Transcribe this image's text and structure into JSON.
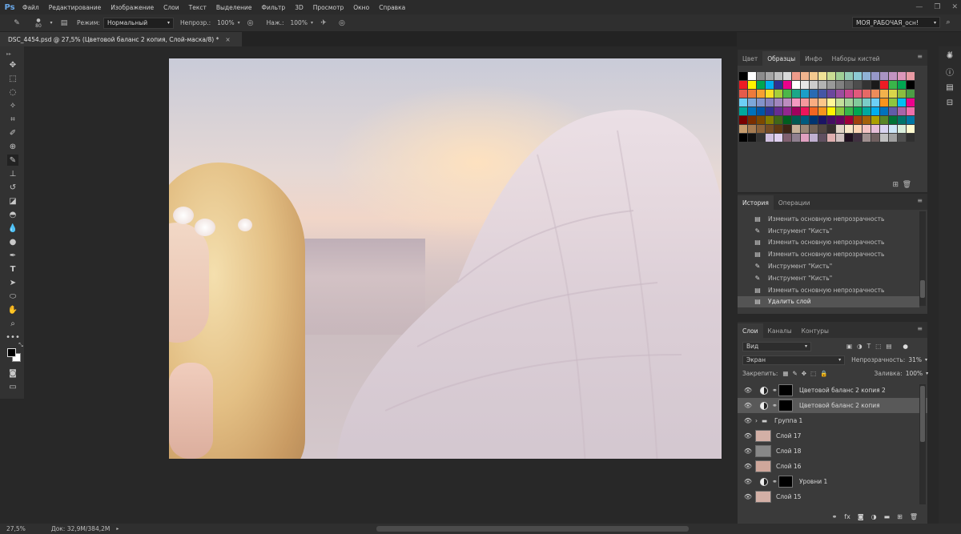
{
  "app": {
    "logo": "Ps"
  },
  "menu": [
    "Файл",
    "Редактирование",
    "Изображение",
    "Слои",
    "Текст",
    "Выделение",
    "Фильтр",
    "3D",
    "Просмотр",
    "Окно",
    "Справка"
  ],
  "options": {
    "brush_size": "80",
    "mode_label": "Режим:",
    "mode_value": "Нормальный",
    "opacity_label": "Непрозр.:",
    "opacity_value": "100%",
    "flow_label": "Наж.:",
    "flow_value": "100%",
    "workspace": "МОЯ_РАБОЧАЯ_осн!"
  },
  "document_tab": {
    "title": "DSC_4454.psd @ 27,5% (Цветовой баланс 2 копия, Слой-маска/8) *",
    "close": "×"
  },
  "swatches_panel": {
    "tabs": [
      "Цвет",
      "Образцы",
      "Инфо",
      "Наборы кистей"
    ],
    "active_tab": 1,
    "colors": [
      [
        "#000000",
        "#ffffff",
        "#8c8c8c",
        "#a6a6a6",
        "#bfbfbf",
        "#d9d9d9",
        "#ee9b8a",
        "#f0b48e",
        "#f3c98f",
        "#f0e397",
        "#c9dd93",
        "#9fcf95",
        "#93cbb6",
        "#8ccbd5",
        "#8fb2d6",
        "#9698c9",
        "#a994c3",
        "#c394c2",
        "#dc97ba",
        "#e99aa3"
      ],
      [
        "#ed1c24",
        "#fff200",
        "#00a651",
        "#00aeef",
        "#2e3192",
        "#ec008c",
        "#ffffff",
        "#e6e6e6",
        "#cccccc",
        "#b3b3b3",
        "#999999",
        "#808080",
        "#666666",
        "#4d4d4d",
        "#333333",
        "#1a1a1a",
        "#ed1c24",
        "#39b54a",
        "#00a651",
        "#000000"
      ],
      [
        "#e55b4b",
        "#ee7a3a",
        "#f5a031",
        "#f9e026",
        "#a6ce39",
        "#4cb748",
        "#1aa789",
        "#1b9fc8",
        "#296bb3",
        "#4456a6",
        "#6b479d",
        "#9b4d9f",
        "#c9478f",
        "#e25a7b",
        "#e66966",
        "#ec8c5a",
        "#f3b24c",
        "#d9d64a",
        "#8bbd3f",
        "#4c9e45"
      ],
      [
        "#6dcff6",
        "#7da7d9",
        "#8393ca",
        "#8781bd",
        "#a186be",
        "#bc8dbf",
        "#f49ac1",
        "#f5989d",
        "#f9ad81",
        "#fdc689",
        "#fff799",
        "#c4df9b",
        "#a3d39c",
        "#82ca9c",
        "#7accc8",
        "#6ecff6",
        "#f7941d",
        "#8dc63f",
        "#00bff3",
        "#ec008c"
      ],
      [
        "#00a99d",
        "#0072bc",
        "#0054a6",
        "#2e3192",
        "#662d91",
        "#92278f",
        "#9e005d",
        "#ed145b",
        "#f26522",
        "#f7941d",
        "#fff200",
        "#8dc63f",
        "#39b54a",
        "#00a651",
        "#00a99d",
        "#00aeef",
        "#0072bc",
        "#605ca8",
        "#a864a8",
        "#f06eaa"
      ],
      [
        "#790000",
        "#7b2e00",
        "#7d4900",
        "#827b00",
        "#406618",
        "#005e20",
        "#005952",
        "#005b7f",
        "#003471",
        "#1b1464",
        "#440e62",
        "#630460",
        "#9e0039",
        "#a0410d",
        "#a36209",
        "#aba000",
        "#598527",
        "#007236",
        "#00746b",
        "#0076a3"
      ],
      [
        "#c69c6d",
        "#a67c52",
        "#8c6239",
        "#754c24",
        "#603913",
        "#3c2415",
        "#c7b299",
        "#998675",
        "#736357",
        "#534741",
        "#362f2d",
        "#e0d3c5",
        "#f6e5c6",
        "#fbd3b4",
        "#f4c4c4",
        "#e5bdd7",
        "#d9d4f0",
        "#cde6f7",
        "#d9eedc",
        "#fffbd0"
      ],
      [
        "#000000",
        "#111111",
        "#333333",
        "#d0c0e0",
        "#e0d0f0",
        "#806070",
        "#908090",
        "#e0a0c0",
        "#c0b0d0",
        "#605060",
        "#e0b0b0",
        "#d0c0c0",
        "#201020",
        "#403040",
        "#a09090",
        "#706060",
        "#c0c0c0",
        "#a0a0a0",
        "#505050",
        "#303030"
      ]
    ]
  },
  "history_panel": {
    "tabs": [
      "История",
      "Операции"
    ],
    "items": [
      {
        "icon": "doc",
        "label": "Изменить основную непрозрачность"
      },
      {
        "icon": "brush",
        "label": "Инструмент \"Кисть\""
      },
      {
        "icon": "doc",
        "label": "Изменить основную непрозрачность"
      },
      {
        "icon": "doc",
        "label": "Изменить основную непрозрачность"
      },
      {
        "icon": "brush",
        "label": "Инструмент \"Кисть\""
      },
      {
        "icon": "brush",
        "label": "Инструмент \"Кисть\""
      },
      {
        "icon": "doc",
        "label": "Изменить основную непрозрачность"
      },
      {
        "icon": "doc",
        "label": "Удалить слой"
      }
    ]
  },
  "layers_panel": {
    "tabs": [
      "Слои",
      "Каналы",
      "Контуры"
    ],
    "filter_value": "Вид",
    "blend_mode": "Экран",
    "opacity_label": "Непрозрачность:",
    "opacity_value": "31%",
    "lock_label": "Закрепить:",
    "fill_label": "Заливка:",
    "fill_value": "100%",
    "layers": [
      {
        "name": "Цветовой баланс 2 копия 2",
        "type": "adjustment"
      },
      {
        "name": "Цветовой баланс 2 копия",
        "type": "adjustment",
        "selected": true
      },
      {
        "name": "Группа 1",
        "type": "group"
      },
      {
        "name": "Слой 17",
        "type": "pixel"
      },
      {
        "name": "Слой 18",
        "type": "pixel"
      },
      {
        "name": "Слой 16",
        "type": "pixel"
      },
      {
        "name": "Уровни 1",
        "type": "adjustment"
      },
      {
        "name": "Слой 15",
        "type": "pixel"
      }
    ]
  },
  "status": {
    "zoom": "27,5%",
    "doc_info": "Док: 32,9M/384,2M"
  }
}
